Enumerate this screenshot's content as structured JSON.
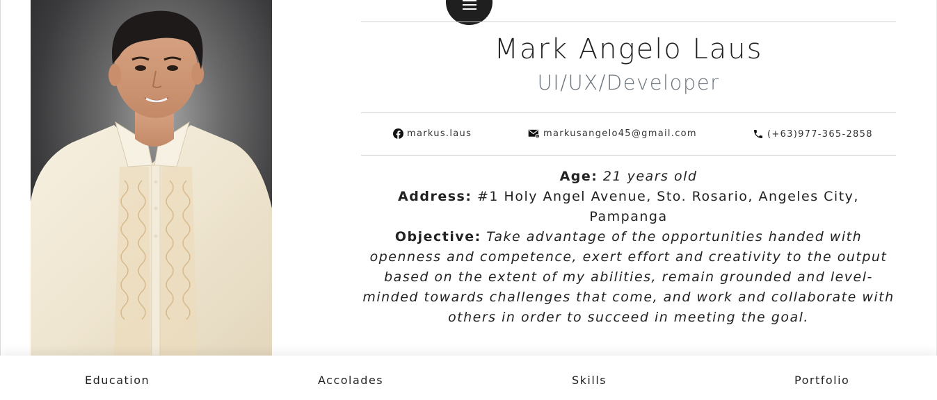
{
  "profile": {
    "name": "Mark Angelo Laus",
    "role": "UI/UX/Developer",
    "photo_alt": "portrait-photo"
  },
  "contacts": {
    "facebook": "markus.laus",
    "email": "markusangelo45@gmail.com",
    "phone": "(+63)977-365-2858"
  },
  "details": {
    "age_label": "Age:",
    "age_value": "21 years old",
    "address_label": "Address:",
    "address_value": "#1 Holy Angel Avenue, Sto. Rosario, Angeles City, Pampanga",
    "objective_label": "Objective:",
    "objective_value": "Take advantage of the opportunities handed with openness and competence, exert effort and creativity to the output based on the extent of my abilities, remain grounded and level-minded towards challenges that come, and work and collaborate with others in order to succeed in meeting the goal."
  },
  "nav": {
    "items": [
      {
        "label": "Education"
      },
      {
        "label": "Accolades"
      },
      {
        "label": "Skills"
      },
      {
        "label": "Portfolio"
      }
    ]
  },
  "icons": {
    "menu": "hamburger-menu-icon",
    "facebook": "facebook-icon",
    "email": "email-icon",
    "phone": "phone-icon"
  },
  "colors": {
    "text": "#222222",
    "muted": "#6c757d",
    "menu_bg": "#1f1f1f",
    "rule": "#cfcfcf"
  }
}
